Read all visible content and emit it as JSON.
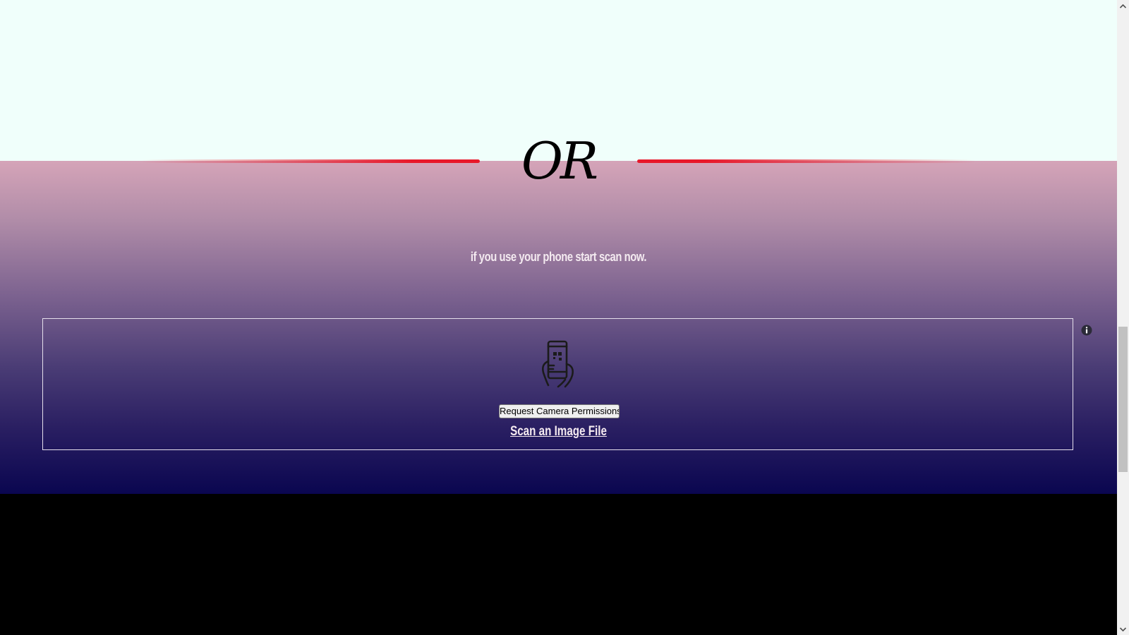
{
  "divider": {
    "label": "OR",
    "line_color": "#e8182a"
  },
  "hint": {
    "text": "if you use your phone start scan now."
  },
  "scanner": {
    "info_icon": "info-icon",
    "phone_icon": "phone-qr-scan-icon",
    "camera_button_label": "Request Camera Permissions",
    "scan_file_link_label": "Scan an Image File"
  },
  "colors": {
    "top_background": "#f0fffb",
    "gradient_top": "#d5a4b8",
    "gradient_bottom": "#0a0650",
    "footer_background": "#000000",
    "accent_line": "#e8182a"
  },
  "scrollbar": {
    "up_icon": "chevron-up-icon",
    "down_icon": "chevron-down-icon"
  }
}
